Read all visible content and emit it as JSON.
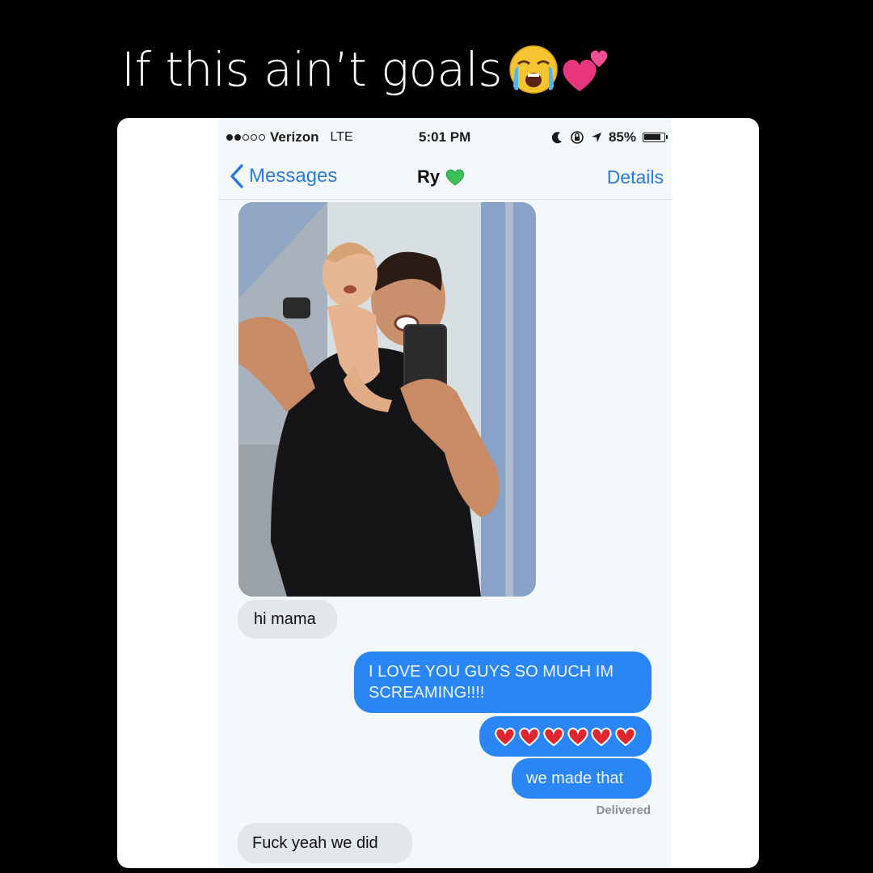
{
  "post": {
    "caption": "If this ain’t goals",
    "caption_emojis": [
      "loudly-crying-face-icon",
      "two-hearts-icon"
    ]
  },
  "status_bar": {
    "carrier": "Verizon",
    "network": "LTE",
    "time": "5:01 PM",
    "battery": "85%",
    "signal_bars_filled": 2,
    "signal_bars_total": 5
  },
  "nav": {
    "back_label": "Messages",
    "contact_name": "Ry",
    "contact_emoji": "green-heart-icon",
    "details_label": "Details"
  },
  "conversation": {
    "photo": "photo-man-holding-baby-selfie",
    "messages": [
      {
        "direction": "incoming",
        "text": "hi mama"
      },
      {
        "direction": "outgoing",
        "text": "I LOVE YOU GUYS SO MUCH IM SCREAMING!!!!"
      },
      {
        "direction": "outgoing",
        "emoji": "red-heart-icon",
        "count": 6
      },
      {
        "direction": "outgoing",
        "text": "we made that"
      },
      {
        "direction": "incoming",
        "text": "Fuck yeah we did"
      }
    ],
    "delivered_label": "Delivered"
  },
  "colors": {
    "background": "#000000",
    "ios_blue": "#2a86f5",
    "link_blue": "#2a7bd8",
    "incoming_bubble": "#e3e6ea"
  }
}
